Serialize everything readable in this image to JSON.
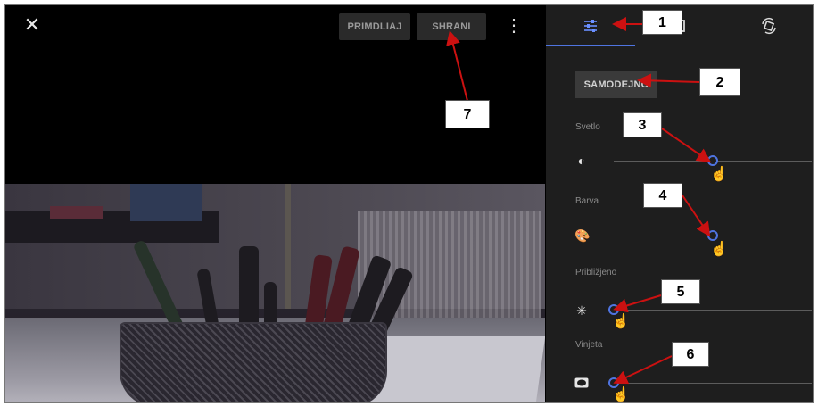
{
  "toolbar": {
    "close_icon": "close-icon",
    "preview_label": "PRIMDLIAJ",
    "save_label": "SHRANI",
    "more_icon": "more-vert-icon"
  },
  "panel": {
    "tabs": [
      {
        "icon": "adjust-sliders-icon",
        "active": true
      },
      {
        "icon": "crop-icon",
        "active": false
      },
      {
        "icon": "rotate-icon",
        "active": false
      }
    ],
    "auto_label": "SAMODEJNO",
    "sliders": [
      {
        "label": "Svetlo",
        "icon": "brightness-icon",
        "value": 0.5
      },
      {
        "label": "Barva",
        "icon": "palette-icon",
        "value": 0.5
      },
      {
        "label": "Približjeno",
        "icon": "sparkle-icon",
        "value": 0.0
      },
      {
        "label": "Vinjeta",
        "icon": "vignette-icon",
        "value": 0.0
      }
    ]
  },
  "callouts": [
    "1",
    "2",
    "3",
    "4",
    "5",
    "6",
    "7"
  ],
  "colors": {
    "accent": "#4f74e0",
    "panel_bg": "#1e1e1e",
    "arrow": "#cc1111"
  }
}
